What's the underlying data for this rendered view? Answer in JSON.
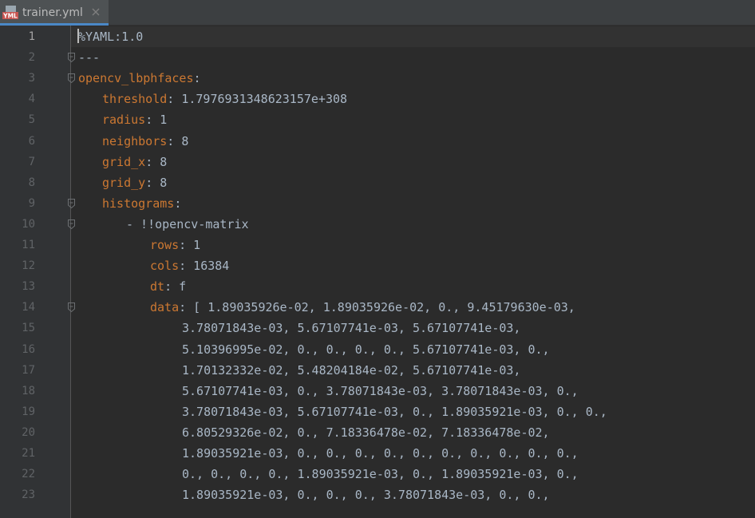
{
  "tab": {
    "filename": "trainer.yml",
    "icon_text": "YML",
    "icon": "yaml-file-icon",
    "close_icon": "close-icon"
  },
  "colors": {
    "background": "#2b2b2b",
    "gutter": "#313335",
    "key": "#cc7832",
    "text": "#a9b7c6",
    "line_number": "#606366"
  },
  "lines": [
    {
      "num": "1",
      "indent": 0,
      "key": "",
      "text": "%YAML:1.0",
      "fold": false
    },
    {
      "num": "2",
      "indent": 0,
      "key": "",
      "text": "---",
      "fold": true
    },
    {
      "num": "3",
      "indent": 0,
      "key": "opencv_lbphfaces",
      "text": ":",
      "fold": true
    },
    {
      "num": "4",
      "indent": 1,
      "key": "threshold",
      "text": ": 1.7976931348623157e+308",
      "fold": false
    },
    {
      "num": "5",
      "indent": 1,
      "key": "radius",
      "text": ": 1",
      "fold": false
    },
    {
      "num": "6",
      "indent": 1,
      "key": "neighbors",
      "text": ": 8",
      "fold": false
    },
    {
      "num": "7",
      "indent": 1,
      "key": "grid_x",
      "text": ": 8",
      "fold": false
    },
    {
      "num": "8",
      "indent": 1,
      "key": "grid_y",
      "text": ": 8",
      "fold": false
    },
    {
      "num": "9",
      "indent": 1,
      "key": "histograms",
      "text": ":",
      "fold": true
    },
    {
      "num": "10",
      "indent": 2,
      "key": "",
      "text": "- !!opencv-matrix",
      "fold": true
    },
    {
      "num": "11",
      "indent": 3,
      "key": "rows",
      "text": ": 1",
      "fold": false
    },
    {
      "num": "12",
      "indent": 3,
      "key": "cols",
      "text": ": 16384",
      "fold": false
    },
    {
      "num": "13",
      "indent": 3,
      "key": "dt",
      "text": ": f",
      "fold": false
    },
    {
      "num": "14",
      "indent": 3,
      "key": "data",
      "text": ": [ 1.89035926e-02, 1.89035926e-02, 0., 9.45179630e-03,",
      "fold": true
    },
    {
      "num": "15",
      "indent": 4,
      "key": "",
      "text": "3.78071843e-03, 5.67107741e-03, 5.67107741e-03,",
      "fold": false
    },
    {
      "num": "16",
      "indent": 4,
      "key": "",
      "text": "5.10396995e-02, 0., 0., 0., 0., 5.67107741e-03, 0.,",
      "fold": false
    },
    {
      "num": "17",
      "indent": 4,
      "key": "",
      "text": "1.70132332e-02, 5.48204184e-02, 5.67107741e-03,",
      "fold": false
    },
    {
      "num": "18",
      "indent": 4,
      "key": "",
      "text": "5.67107741e-03, 0., 3.78071843e-03, 3.78071843e-03, 0.,",
      "fold": false
    },
    {
      "num": "19",
      "indent": 4,
      "key": "",
      "text": "3.78071843e-03, 5.67107741e-03, 0., 1.89035921e-03, 0., 0.,",
      "fold": false
    },
    {
      "num": "20",
      "indent": 4,
      "key": "",
      "text": "6.80529326e-02, 0., 7.18336478e-02, 7.18336478e-02,",
      "fold": false
    },
    {
      "num": "21",
      "indent": 4,
      "key": "",
      "text": "1.89035921e-03, 0., 0., 0., 0., 0., 0., 0., 0., 0., 0.,",
      "fold": false
    },
    {
      "num": "22",
      "indent": 4,
      "key": "",
      "text": "0., 0., 0., 0., 1.89035921e-03, 0., 1.89035921e-03, 0.,",
      "fold": false
    },
    {
      "num": "23",
      "indent": 4,
      "key": "",
      "text": "1.89035921e-03, 0., 0., 0., 3.78071843e-03, 0., 0.,",
      "fold": false
    }
  ]
}
